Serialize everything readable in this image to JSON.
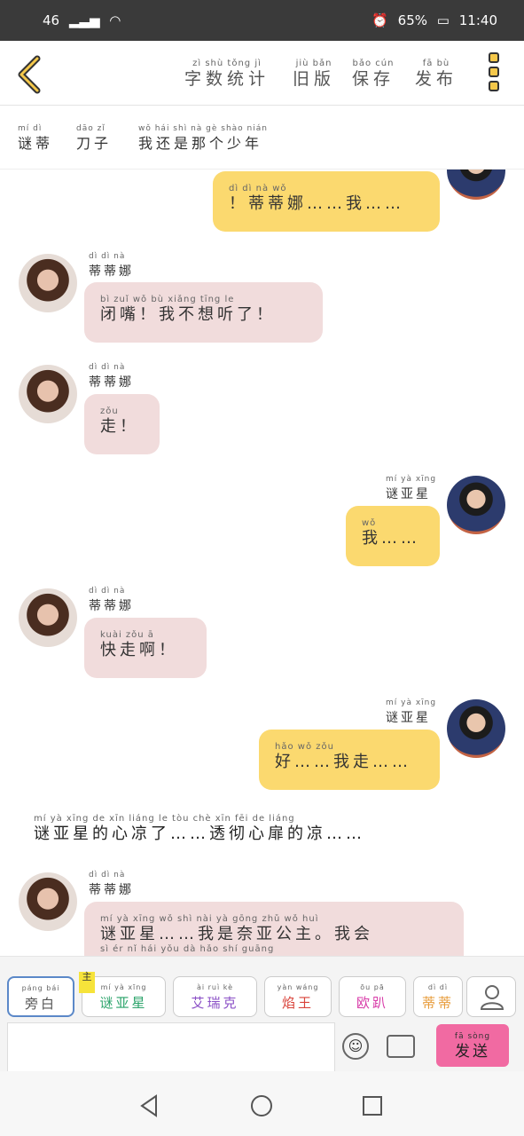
{
  "status": {
    "signal": "46",
    "battery": "65%",
    "time": "11:40"
  },
  "menu": [
    {
      "py": "zì shù tǒng jì",
      "hz": "字数统计"
    },
    {
      "py": "jiù bǎn",
      "hz": "旧版"
    },
    {
      "py": "bǎo cún",
      "hz": "保存"
    },
    {
      "py": "fā bù",
      "hz": "发布"
    }
  ],
  "tags": [
    {
      "py": "mí dì",
      "hz": "谜蒂"
    },
    {
      "py": "dāo zǐ",
      "hz": "刀子"
    },
    {
      "py": "wǒ hái shì nà gè shào nián",
      "hz": "我还是那个少年"
    }
  ],
  "names": {
    "didina": {
      "py": "dì dì nà",
      "hz": "蒂蒂娜"
    },
    "miyaxing": {
      "py": "mí yà xīng",
      "hz": "谜亚星"
    }
  },
  "messages": [
    {
      "py": "dì dì nà        wǒ",
      "hz": "！蒂蒂娜……我……"
    },
    {
      "py": "bì zuǐ  wǒ bù xiǎng tīng le",
      "hz": "闭嘴！我不想听了！"
    },
    {
      "py": "zǒu",
      "hz": "走！"
    },
    {
      "py": "wǒ",
      "hz": "我……"
    },
    {
      "py": "kuài zǒu ā",
      "hz": "快走啊！"
    },
    {
      "py": "hǎo       wǒ zǒu",
      "hz": "好……我走……"
    },
    {
      "py": "mí yà xīng       wǒ shì nài yà gōng zhǔ   wǒ huì",
      "hz": "谜亚星……我是奈亚公主。我会",
      "py2": "sì           ér nǐ hái yǒu dà hǎo shí guāng"
    }
  ],
  "narration": {
    "py": "mí yà xīng de xīn liáng le      tòu chè xīn fēi de liáng",
    "hz": "谜亚星的心凉了……透彻心扉的凉……"
  },
  "characters": [
    {
      "py": "páng bái",
      "hz": "旁白",
      "color": "#333333"
    },
    {
      "py": "mí yà xīng",
      "hz": "谜亚星",
      "color": "#2aa36a",
      "badge": "主"
    },
    {
      "py": "ài ruì kè",
      "hz": "艾瑞克",
      "color": "#8a4fc6"
    },
    {
      "py": "yàn wáng",
      "hz": "焰王",
      "color": "#d9433a"
    },
    {
      "py": "ōu pā",
      "hz": "欧趴",
      "color": "#d83aa8"
    },
    {
      "py": "dì dì",
      "hz": "蒂蒂",
      "color": "#e79b3a"
    }
  ],
  "send": {
    "py": "fā sòng",
    "hz": "发送"
  }
}
